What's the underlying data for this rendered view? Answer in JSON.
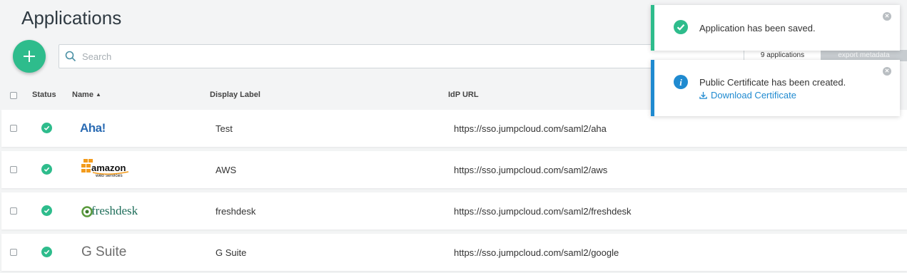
{
  "page": {
    "title": "Applications"
  },
  "toolbar": {
    "add_label": "+",
    "search_placeholder": "Search",
    "app_count": "9 applications",
    "export_label": "export metadata"
  },
  "table": {
    "columns": {
      "status": "Status",
      "name": "Name",
      "display_label": "Display Label",
      "idp_url": "IdP URL"
    },
    "rows": [
      {
        "name": "Aha!",
        "display_label": "Test",
        "idp_url": "https://sso.jumpcloud.com/saml2/aha"
      },
      {
        "name": "amazon web services",
        "display_label": "AWS",
        "idp_url": "https://sso.jumpcloud.com/saml2/aws"
      },
      {
        "name": "freshdesk",
        "display_label": "freshdesk",
        "idp_url": "https://sso.jumpcloud.com/saml2/freshdesk"
      },
      {
        "name": "G Suite",
        "display_label": "G Suite",
        "idp_url": "https://sso.jumpcloud.com/saml2/google"
      }
    ]
  },
  "toasts": [
    {
      "type": "success",
      "message": "Application has been saved."
    },
    {
      "type": "info",
      "message": "Public Certificate has been created.",
      "link": "Download Certificate"
    }
  ],
  "colors": {
    "success": "#2ebc8c",
    "info": "#1f8ad0"
  }
}
